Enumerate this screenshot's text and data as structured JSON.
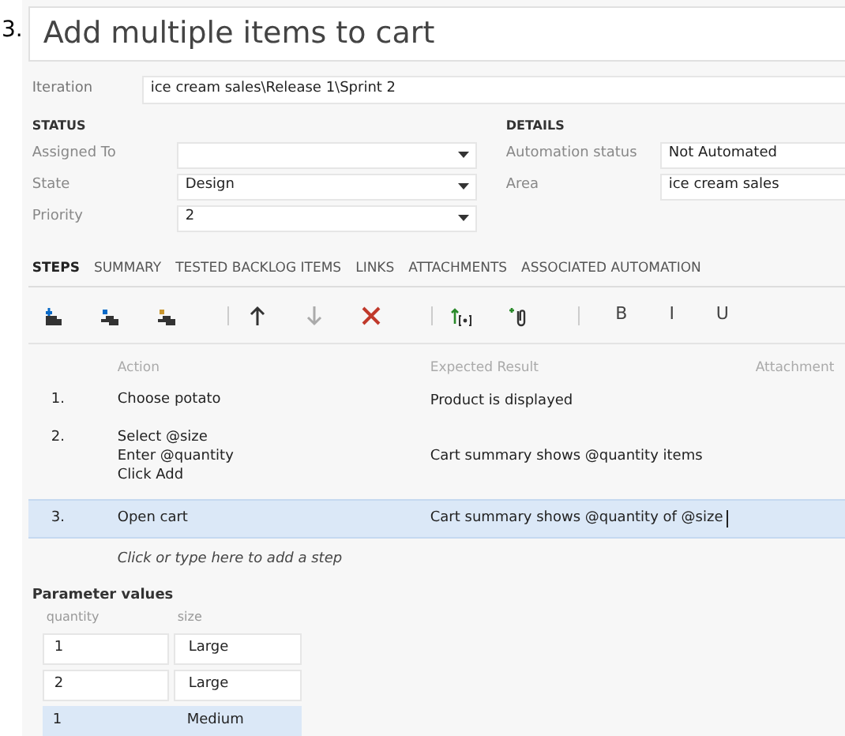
{
  "question_number": "3.",
  "title": "Add multiple items to cart",
  "iteration": {
    "label": "Iteration",
    "value": "ice cream sales\\Release 1\\Sprint 2"
  },
  "status": {
    "heading": "STATUS",
    "fields": [
      {
        "label": "Assigned To"
      },
      {
        "label": "State",
        "value": "Design"
      },
      {
        "label": "Priority",
        "value": "2"
      }
    ]
  },
  "details": {
    "heading": "DETAILS",
    "fields": [
      {
        "label": "Automation status",
        "value": "Not Automated"
      },
      {
        "label": "Area",
        "value": "ice cream sales"
      }
    ]
  },
  "tabs": [
    {
      "label": "STEPS",
      "selected": true
    },
    {
      "label": "SUMMARY",
      "selected": false
    },
    {
      "label": "TESTED BACKLOG ITEMS",
      "selected": false
    },
    {
      "label": "LINKS",
      "selected": false
    },
    {
      "label": "ATTACHMENTS",
      "selected": false
    },
    {
      "label": "ASSOCIATED AUTOMATION",
      "selected": false
    }
  ],
  "toolbar": [
    {
      "kind": "insert-step"
    },
    {
      "kind": "insert-shared"
    },
    {
      "kind": "create-shared"
    },
    {
      "kind": "sep"
    },
    {
      "kind": "up"
    },
    {
      "kind": "down",
      "disabled": true
    },
    {
      "kind": "delete"
    },
    {
      "kind": "sep"
    },
    {
      "kind": "parameter"
    },
    {
      "kind": "attach"
    },
    {
      "kind": "sep"
    },
    {
      "kind": "text",
      "label": "B"
    },
    {
      "kind": "text",
      "label": "I"
    },
    {
      "kind": "text",
      "label": "U"
    }
  ],
  "steps": {
    "columns": [
      "Action",
      "Expected Result",
      "Attachment"
    ],
    "rows": [
      {
        "number": "1.",
        "action": [
          "Choose potato"
        ],
        "expected": "Product is displayed",
        "selected": false
      },
      {
        "number": "2.",
        "action": [
          "Select @size",
          "Enter @quantity",
          "Click Add"
        ],
        "expected": "Cart summary shows @quantity items",
        "selected": false
      },
      {
        "number": "3.",
        "action": [
          "Open cart"
        ],
        "expected": "Cart summary shows @quantity of @size",
        "selected": true
      }
    ],
    "add_step": "Click or type here to add a step"
  },
  "parameters": {
    "heading": "Parameter values",
    "columns": [
      "quantity",
      "size"
    ],
    "rows": [
      {
        "cells": [
          "1",
          "Large"
        ],
        "selected": false
      },
      {
        "cells": [
          "2",
          "Large"
        ],
        "selected": false
      },
      {
        "cells": [
          "1",
          "Medium"
        ],
        "selected": true
      }
    ]
  }
}
